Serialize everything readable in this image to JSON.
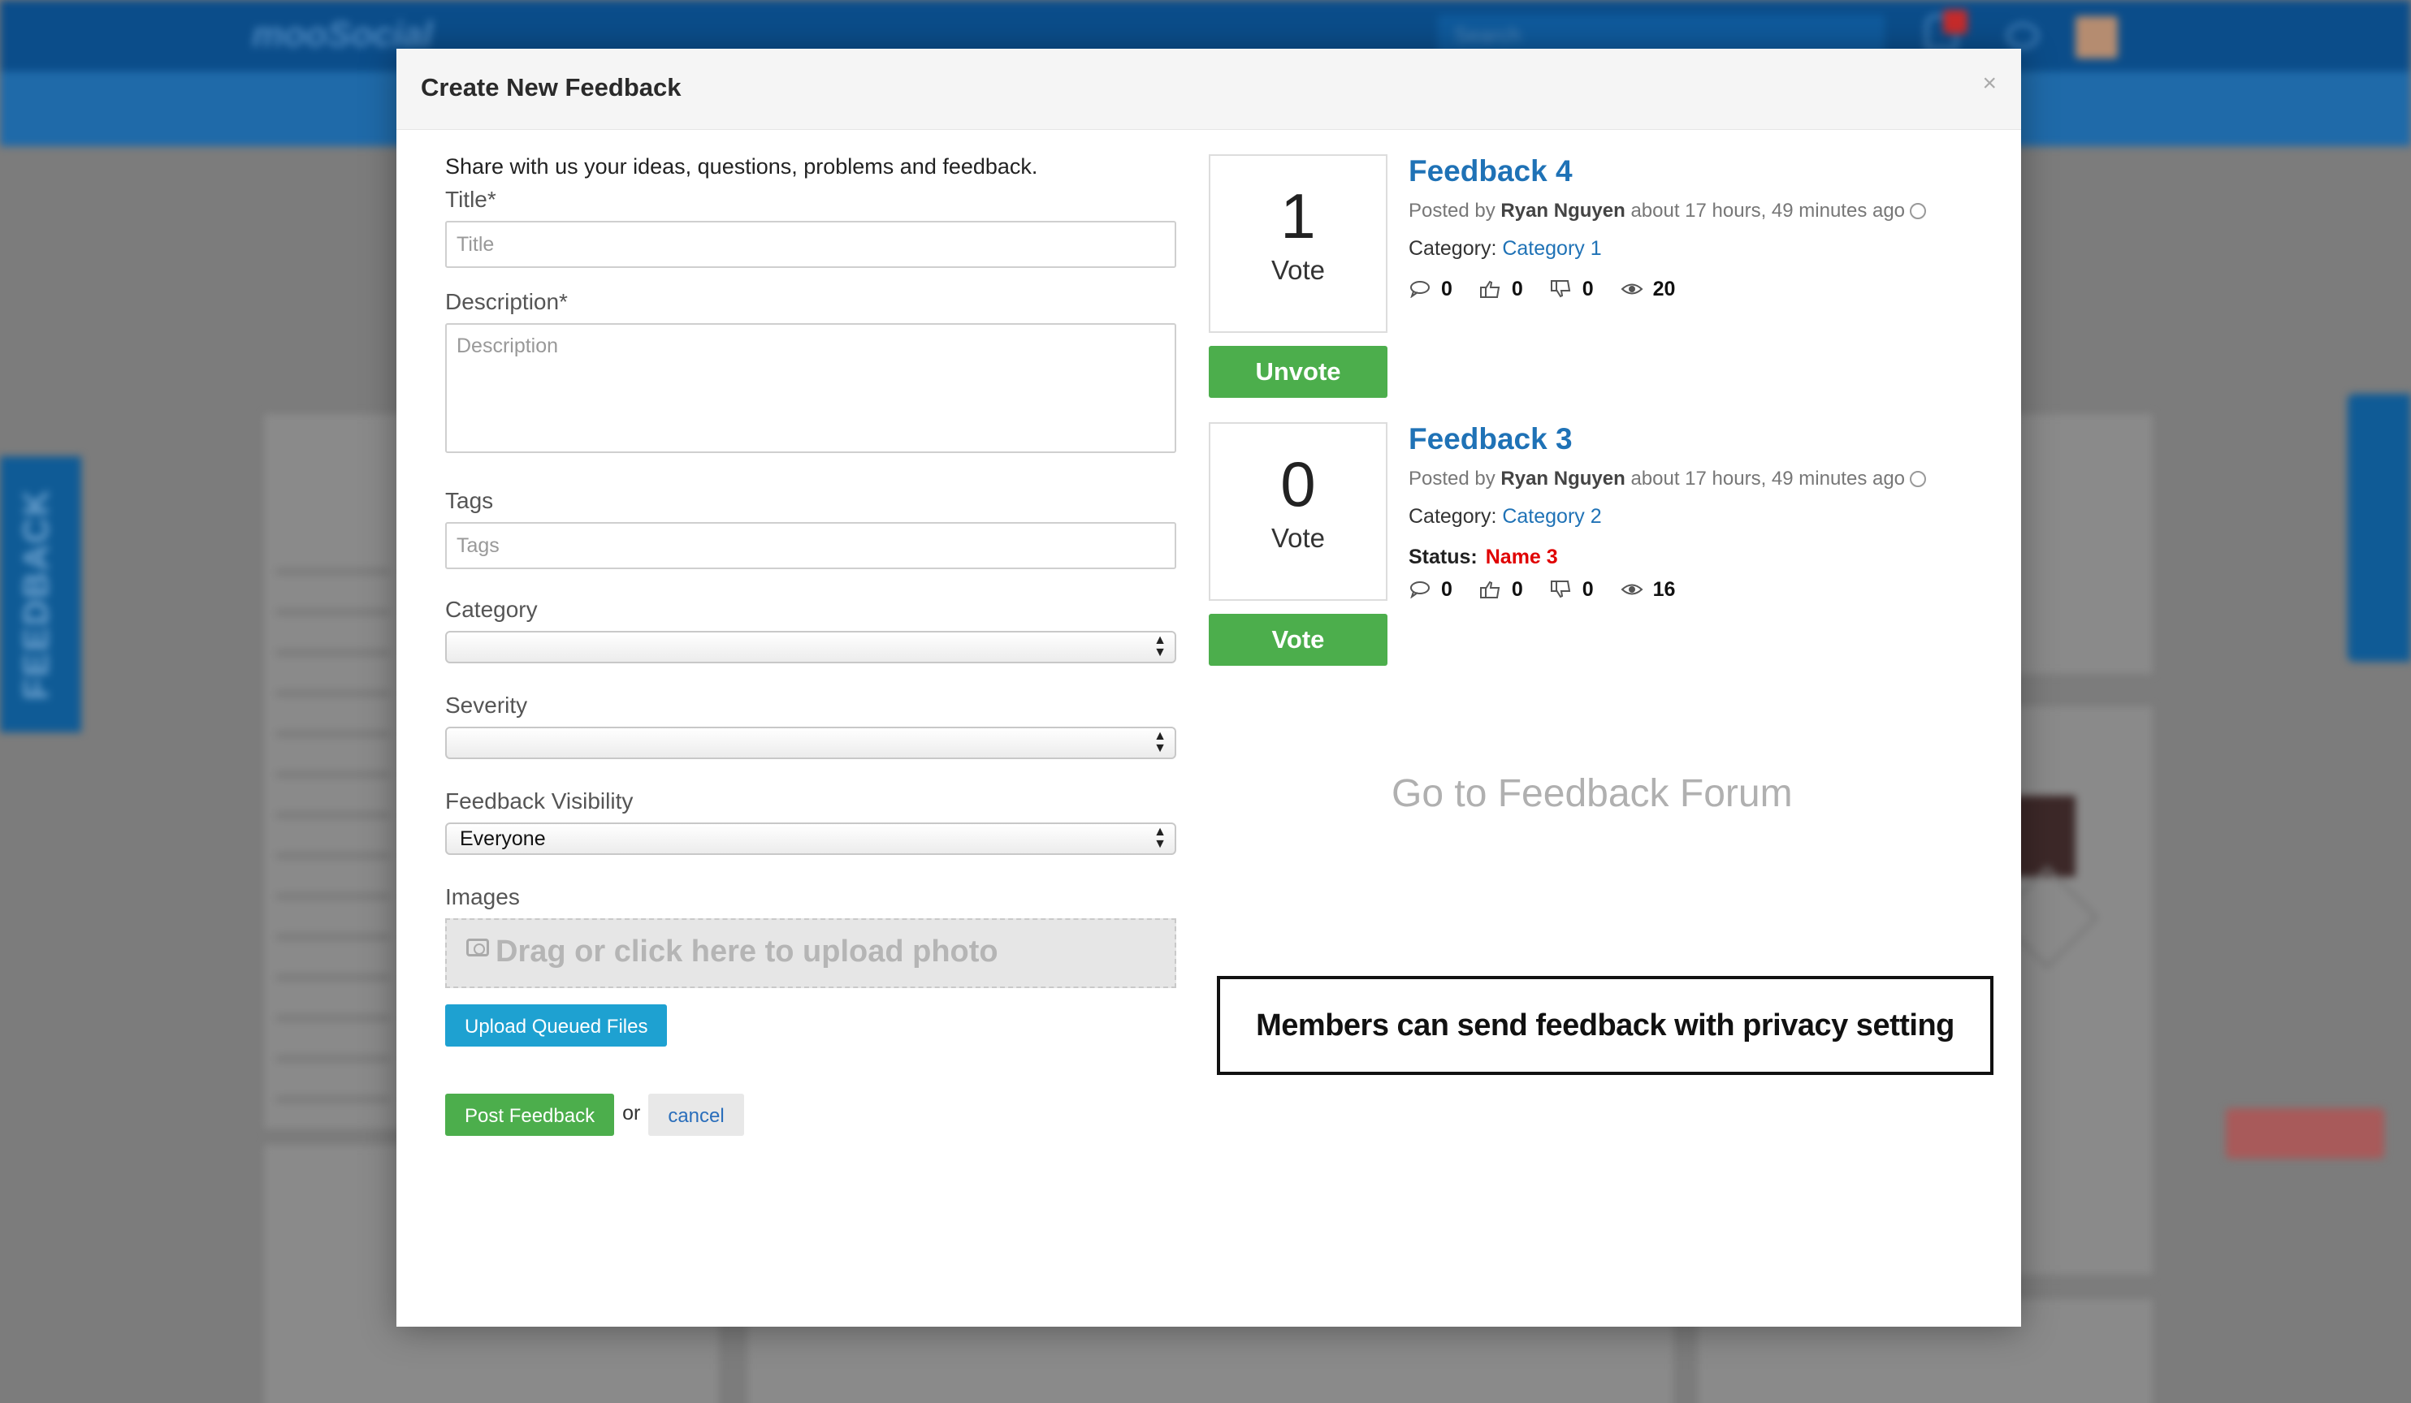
{
  "background": {
    "logo": "mooSocial",
    "search_placeholder": "Search",
    "feedback_tab": "FEEDBACK"
  },
  "modal": {
    "title": "Create New Feedback",
    "close": "×",
    "intro": "Share with us your ideas, questions, problems and feedback.",
    "form": {
      "title_label": "Title*",
      "title_placeholder": "Title",
      "description_label": "Description*",
      "description_placeholder": "Description",
      "tags_label": "Tags",
      "tags_placeholder": "Tags",
      "category_label": "Category",
      "category_value": "",
      "severity_label": "Severity",
      "severity_value": "",
      "visibility_label": "Feedback Visibility",
      "visibility_value": "Everyone",
      "images_label": "Images",
      "upload_text": "Drag or click here to upload photo",
      "upload_queued": "Upload Queued Files",
      "post": "Post Feedback",
      "or": "or",
      "cancel": "cancel"
    },
    "feedbacks": [
      {
        "votes": "1",
        "vote_label": "Vote",
        "button": "Unvote",
        "title": "Feedback 4",
        "posted_by": "Posted by",
        "author": "Ryan Nguyen",
        "time": "about 17 hours, 49 minutes ago",
        "category_label": "Category:",
        "category": "Category 1",
        "status_label": "",
        "status": "",
        "comments": "0",
        "likes": "0",
        "dislikes": "0",
        "views": "20"
      },
      {
        "votes": "0",
        "vote_label": "Vote",
        "button": "Vote",
        "title": "Feedback 3",
        "posted_by": "Posted by",
        "author": "Ryan Nguyen",
        "time": "about 17 hours, 49 minutes ago",
        "category_label": "Category:",
        "category": "Category 2",
        "status_label": "Status:",
        "status": "Name 3",
        "comments": "0",
        "likes": "0",
        "dislikes": "0",
        "views": "16"
      }
    ],
    "forum_link": "Go to Feedback Forum",
    "note": "Members can send feedback with privacy setting"
  }
}
